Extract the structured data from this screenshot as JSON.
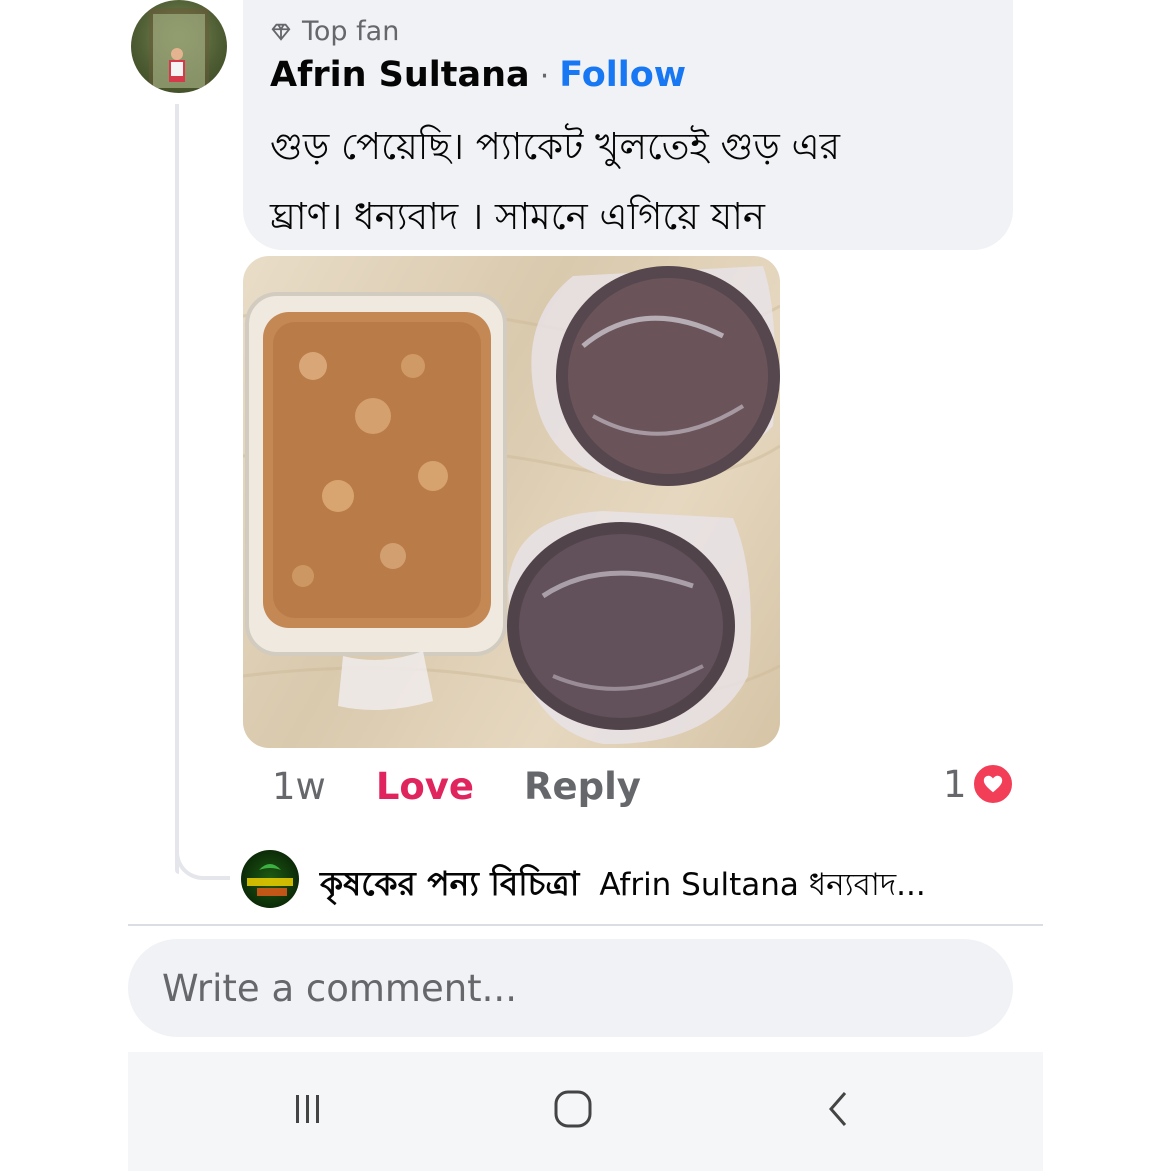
{
  "comment": {
    "badge_label": "Top fan",
    "badge_icon": "diamond-icon",
    "author": "Afrin Sultana",
    "separator": "·",
    "follow_label": "Follow",
    "text_line1": "গুড় পেয়েছি। প্যাকেট খুলতেই গুড় এর",
    "text_line2": "ঘ্রাণ।  ধন্যবাদ । সামনে এগিয়ে যান",
    "time": "1w",
    "love_label": "Love",
    "reply_label": "Reply",
    "reaction_count": "1",
    "reaction_icon": "heart-icon"
  },
  "reply": {
    "author": "কৃষকের পন্য বিচিত্রা",
    "preview": "Afrin Sultana ধন্যবাদ..."
  },
  "composer": {
    "placeholder": "Write a comment..."
  },
  "navbar": {
    "recents_icon": "recents-icon",
    "home_icon": "home-icon",
    "back_icon": "back-icon"
  },
  "colors": {
    "accent": "#1877f2",
    "love": "#e0245e",
    "heart": "#f33e58",
    "bubble": "#f0f2f5"
  }
}
